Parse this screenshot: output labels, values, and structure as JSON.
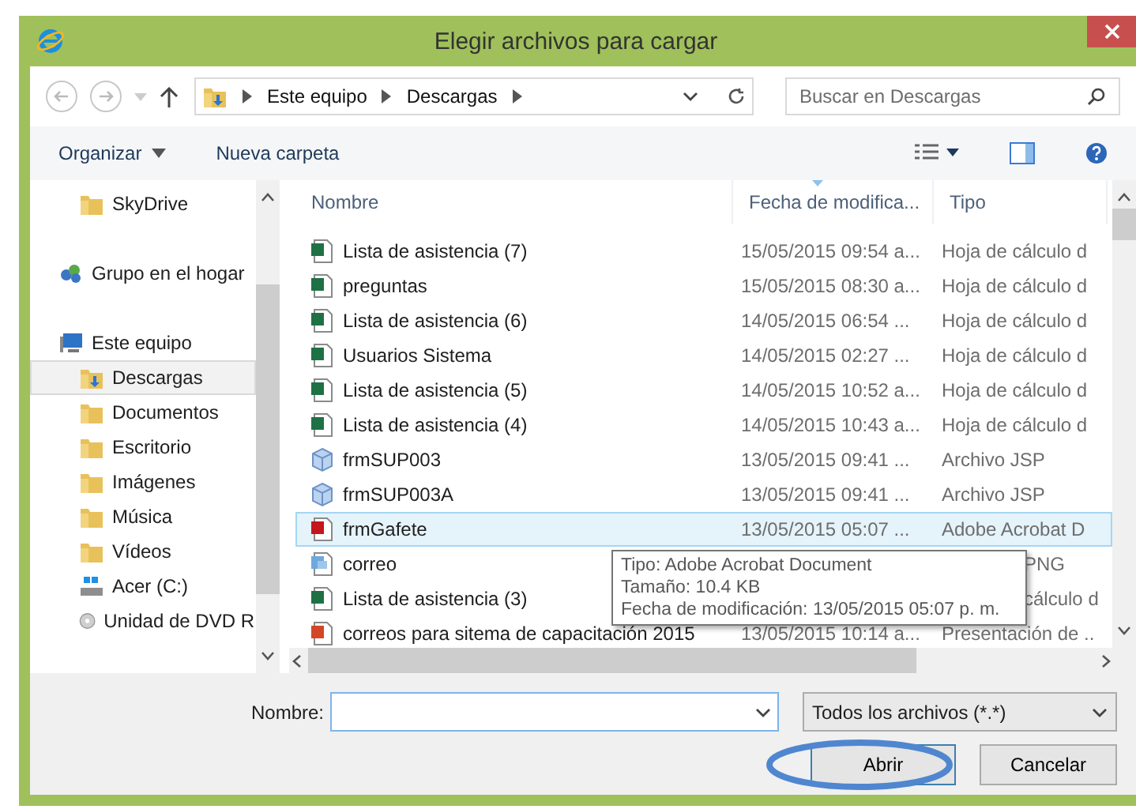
{
  "window": {
    "title": "Elegir archivos para cargar"
  },
  "address": {
    "crumbs": [
      "Este equipo",
      "Descargas"
    ]
  },
  "search": {
    "placeholder": "Buscar en Descargas"
  },
  "toolbar": {
    "items": [
      "Organizar",
      "Nueva carpeta"
    ]
  },
  "sidebar": {
    "items": [
      {
        "label": "SkyDrive",
        "kind": "folder",
        "selected": false
      },
      {
        "label": "Grupo en el hogar",
        "kind": "homegroup",
        "selected": false
      },
      {
        "label": "Este equipo",
        "kind": "computer",
        "selected": false,
        "children": [
          {
            "label": "Descargas",
            "kind": "downloads",
            "selected": true
          },
          {
            "label": "Documentos",
            "kind": "folder",
            "selected": false
          },
          {
            "label": "Escritorio",
            "kind": "folder",
            "selected": false
          },
          {
            "label": "Imágenes",
            "kind": "folder",
            "selected": false
          },
          {
            "label": "Música",
            "kind": "folder",
            "selected": false
          },
          {
            "label": "Vídeos",
            "kind": "folder",
            "selected": false
          },
          {
            "label": "Acer (C:)",
            "kind": "drive",
            "selected": false
          },
          {
            "label": "Unidad de DVD R",
            "kind": "dvd",
            "selected": false
          }
        ]
      }
    ]
  },
  "table": {
    "columns": [
      "Nombre",
      "Fecha de modifica...",
      "Tipo"
    ],
    "rows": [
      {
        "name": "Lista de asistencia (7)",
        "kind": "excel",
        "date": "15/05/2015 09:54 a...",
        "type": "Hoja de cálculo d",
        "selected": false
      },
      {
        "name": "preguntas",
        "kind": "excel",
        "date": "15/05/2015 08:30 a...",
        "type": "Hoja de cálculo d",
        "selected": false
      },
      {
        "name": "Lista de asistencia (6)",
        "kind": "excel",
        "date": "14/05/2015 06:54 ...",
        "type": "Hoja de cálculo d",
        "selected": false
      },
      {
        "name": "Usuarios Sistema",
        "kind": "excel",
        "date": "14/05/2015 02:27 ...",
        "type": "Hoja de cálculo d",
        "selected": false
      },
      {
        "name": "Lista de asistencia (5)",
        "kind": "excel",
        "date": "14/05/2015 10:52 a...",
        "type": "Hoja de cálculo d",
        "selected": false
      },
      {
        "name": "Lista de asistencia (4)",
        "kind": "excel",
        "date": "14/05/2015 10:43 a...",
        "type": "Hoja de cálculo d",
        "selected": false
      },
      {
        "name": "frmSUP003",
        "kind": "jsp",
        "date": "13/05/2015 09:41 ...",
        "type": "Archivo JSP",
        "selected": false
      },
      {
        "name": "frmSUP003A",
        "kind": "jsp",
        "date": "13/05/2015 09:41 ...",
        "type": "Archivo JSP",
        "selected": false
      },
      {
        "name": "frmGafete",
        "kind": "pdf",
        "date": "13/05/2015 05:07 ...",
        "type": "Adobe Acrobat D",
        "selected": true
      },
      {
        "name": "correo",
        "kind": "image",
        "type": "PNG",
        "selected": false
      },
      {
        "name": "Lista de asistencia (3)",
        "kind": "excel",
        "type": "cálculo d",
        "selected": false
      },
      {
        "name": "correos para sitema de capacitación 2015",
        "kind": "ppt",
        "date": "13/05/2015 10:14 a...",
        "type": "Presentación de ..",
        "selected": false
      }
    ]
  },
  "tooltip": {
    "lines": [
      "Tipo: Adobe Acrobat Document",
      "Tamaño: 10.4 KB",
      "Fecha de modificación: 13/05/2015 05:07 p. m."
    ]
  },
  "footer": {
    "name_label": "Nombre:",
    "filter": "Todos los archivos (*.*)",
    "buttons": [
      "Abrir",
      "Cancelar"
    ]
  }
}
